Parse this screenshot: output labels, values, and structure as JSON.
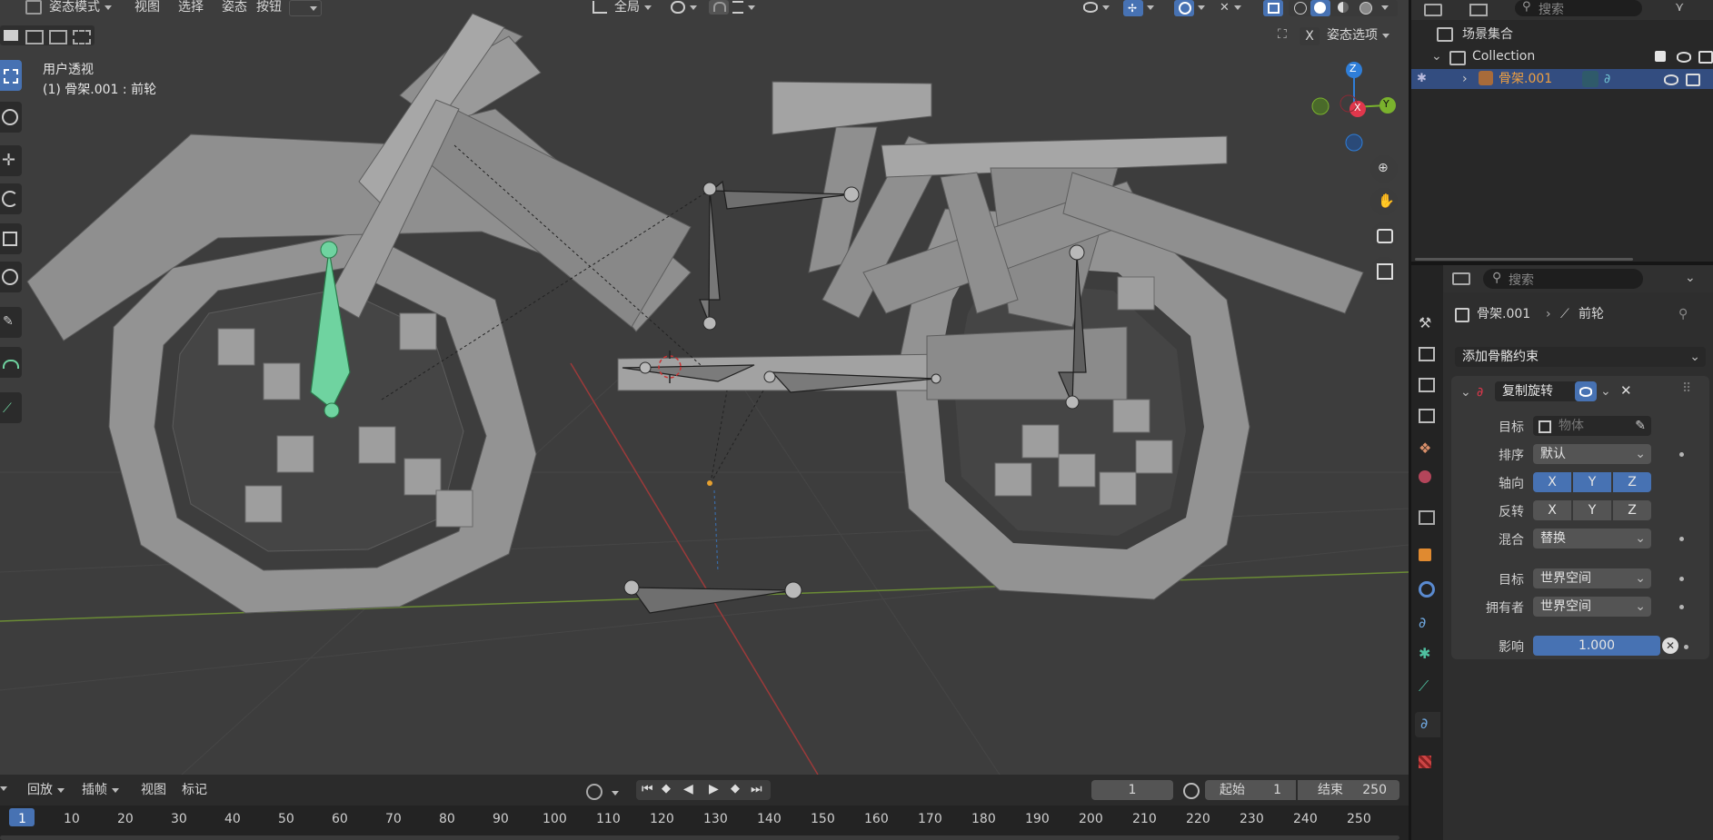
{
  "header": {
    "mode_label": "姿态模式",
    "menu": [
      "视图",
      "选择",
      "姿态",
      "按钮"
    ],
    "transform_orientation": "全局",
    "pose_options_label": "姿态选项",
    "axis_x_label": "X"
  },
  "viewport": {
    "view_name": "用户透视",
    "selection_info": "(1) 骨架.001 : 前轮",
    "gizmo_axes": {
      "x": "X",
      "y": "Y",
      "z": "Z"
    }
  },
  "timeline": {
    "menu": [
      "回放",
      "插帧",
      "视图",
      "标记"
    ],
    "current_frame": "1",
    "start_label": "起始",
    "start_value": "1",
    "end_label": "结束",
    "end_value": "250",
    "ruler_ticks": [
      "1",
      "10",
      "20",
      "30",
      "40",
      "50",
      "60",
      "70",
      "80",
      "90",
      "100",
      "110",
      "120",
      "130",
      "140",
      "150",
      "160",
      "170",
      "180",
      "190",
      "200",
      "210",
      "220",
      "230",
      "240",
      "250"
    ]
  },
  "outliner": {
    "search_placeholder": "搜索",
    "scene_collection": "场景集合",
    "collection": "Collection",
    "armature": "骨架.001"
  },
  "properties": {
    "search_placeholder": "搜索",
    "breadcrumb_object": "骨架.001",
    "breadcrumb_bone": "前轮",
    "add_constraint": "添加骨骼约束",
    "constraint_name": "复制旋转",
    "target_label": "目标",
    "target_placeholder": "物体",
    "order_label": "排序",
    "order_value": "默认",
    "axis_label": "轴向",
    "axis": [
      "X",
      "Y",
      "Z"
    ],
    "invert_label": "反转",
    "invert": [
      "X",
      "Y",
      "Z"
    ],
    "mix_label": "混合",
    "mix_value": "替换",
    "target_space_label": "目标",
    "target_space_value": "世界空间",
    "owner_label": "拥有者",
    "owner_space_value": "世界空间",
    "influence_label": "影响",
    "influence_value": "1.000"
  },
  "colors": {
    "accent": "#4772b3",
    "selected_bone": "#6fd3a0",
    "active_object": "#f0a040",
    "axis_x": "#e0374c",
    "axis_y": "#7ab22d",
    "axis_z": "#2f7ed8"
  }
}
